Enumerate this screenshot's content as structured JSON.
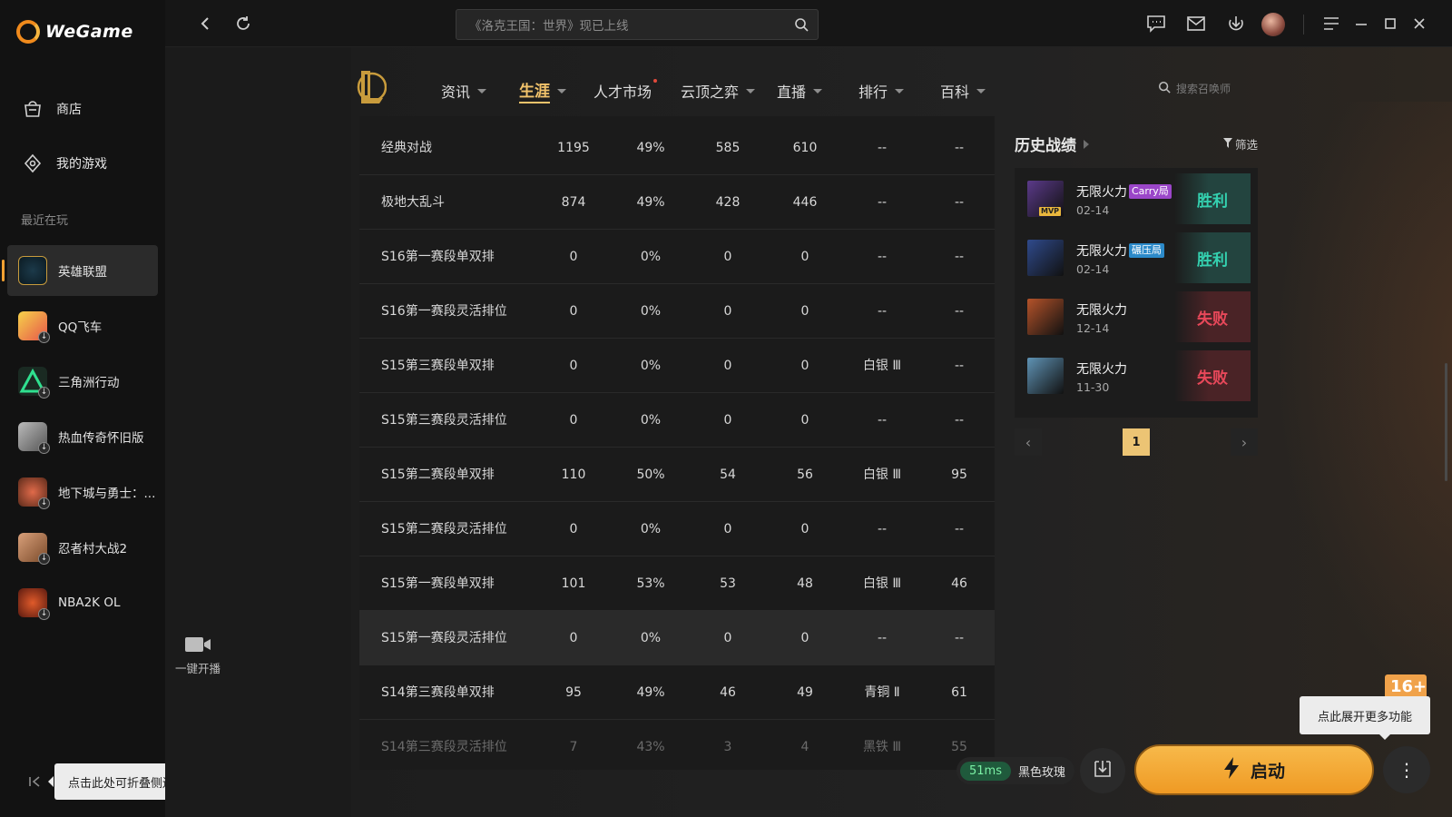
{
  "app": {
    "name": "WeGame"
  },
  "sidebar": {
    "nav": [
      {
        "label": "商店",
        "icon": "store-icon"
      },
      {
        "label": "我的游戏",
        "icon": "my-games-icon"
      }
    ],
    "recent_label": "最近在玩",
    "games": [
      {
        "label": "英雄联盟",
        "active": true,
        "download": false
      },
      {
        "label": "QQ飞车",
        "active": false,
        "download": true
      },
      {
        "label": "三角洲行动",
        "active": false,
        "download": true
      },
      {
        "label": "热血传奇怀旧版",
        "active": false,
        "download": true
      },
      {
        "label": "地下城与勇士：...",
        "active": false,
        "download": true
      },
      {
        "label": "忍者村大战2",
        "active": false,
        "download": true
      },
      {
        "label": "NBA2K OL",
        "active": false,
        "download": true
      }
    ],
    "collapse_tip": "点击此处可折叠侧边栏"
  },
  "live": {
    "label": "一键开播"
  },
  "topbar": {
    "search_placeholder": "《洛克王国：世界》现已上线"
  },
  "tabs": [
    {
      "label": "资讯",
      "caret": true
    },
    {
      "label": "生涯",
      "caret": true,
      "active": true
    },
    {
      "label": "人才市场",
      "caret": false,
      "dot": true
    },
    {
      "label": "云顶之弈",
      "caret": true
    },
    {
      "label": "直播",
      "caret": true
    },
    {
      "label": "排行",
      "caret": true
    },
    {
      "label": "百科",
      "caret": true
    }
  ],
  "summoner_search_placeholder": "搜索召唤师",
  "table": {
    "rows": [
      [
        "经典对战",
        "1195",
        "49%",
        "585",
        "610",
        "--",
        "--"
      ],
      [
        "极地大乱斗",
        "874",
        "49%",
        "428",
        "446",
        "--",
        "--"
      ],
      [
        "S16第一赛段单双排",
        "0",
        "0%",
        "0",
        "0",
        "--",
        "--"
      ],
      [
        "S16第一赛段灵活排位",
        "0",
        "0%",
        "0",
        "0",
        "--",
        "--"
      ],
      [
        "S15第三赛段单双排",
        "0",
        "0%",
        "0",
        "0",
        "白银 Ⅲ",
        "--"
      ],
      [
        "S15第三赛段灵活排位",
        "0",
        "0%",
        "0",
        "0",
        "--",
        "--"
      ],
      [
        "S15第二赛段单双排",
        "110",
        "50%",
        "54",
        "56",
        "白银 Ⅲ",
        "95"
      ],
      [
        "S15第二赛段灵活排位",
        "0",
        "0%",
        "0",
        "0",
        "--",
        "--"
      ],
      [
        "S15第一赛段单双排",
        "101",
        "53%",
        "53",
        "48",
        "白银 Ⅲ",
        "46"
      ],
      [
        "S15第一赛段灵活排位",
        "0",
        "0%",
        "0",
        "0",
        "--",
        "--"
      ],
      [
        "S14第三赛段单双排",
        "95",
        "49%",
        "46",
        "49",
        "青铜 Ⅱ",
        "61"
      ],
      [
        "S14第三赛段灵活排位",
        "7",
        "43%",
        "3",
        "4",
        "黑铁 Ⅲ",
        "55"
      ]
    ]
  },
  "history": {
    "title": "历史战绩",
    "filter_label": "筛选",
    "matches": [
      {
        "mode": "无限火力",
        "tag": "Carry局",
        "tag_type": "carry",
        "date": "02-14",
        "result": "胜利",
        "win": true,
        "mvp": "MVP",
        "champ_color": "#5b3a8a"
      },
      {
        "mode": "无限火力",
        "tag": "碾压局",
        "tag_type": "crush",
        "date": "02-14",
        "result": "胜利",
        "win": true,
        "mvp": "",
        "champ_color": "#2f4a8c"
      },
      {
        "mode": "无限火力",
        "tag": "",
        "tag_type": "",
        "date": "12-14",
        "result": "失败",
        "win": false,
        "mvp": "",
        "champ_color": "#b5532a"
      },
      {
        "mode": "无限火力",
        "tag": "",
        "tag_type": "",
        "date": "11-30",
        "result": "失败",
        "win": false,
        "mvp": "",
        "champ_color": "#5f93b5"
      }
    ],
    "page": "1"
  },
  "bottom": {
    "ping": "51ms",
    "server": "黑色玫瑰",
    "launch_label": "启动",
    "more_tip": "点此展开更多功能",
    "age_badge": "16+"
  }
}
